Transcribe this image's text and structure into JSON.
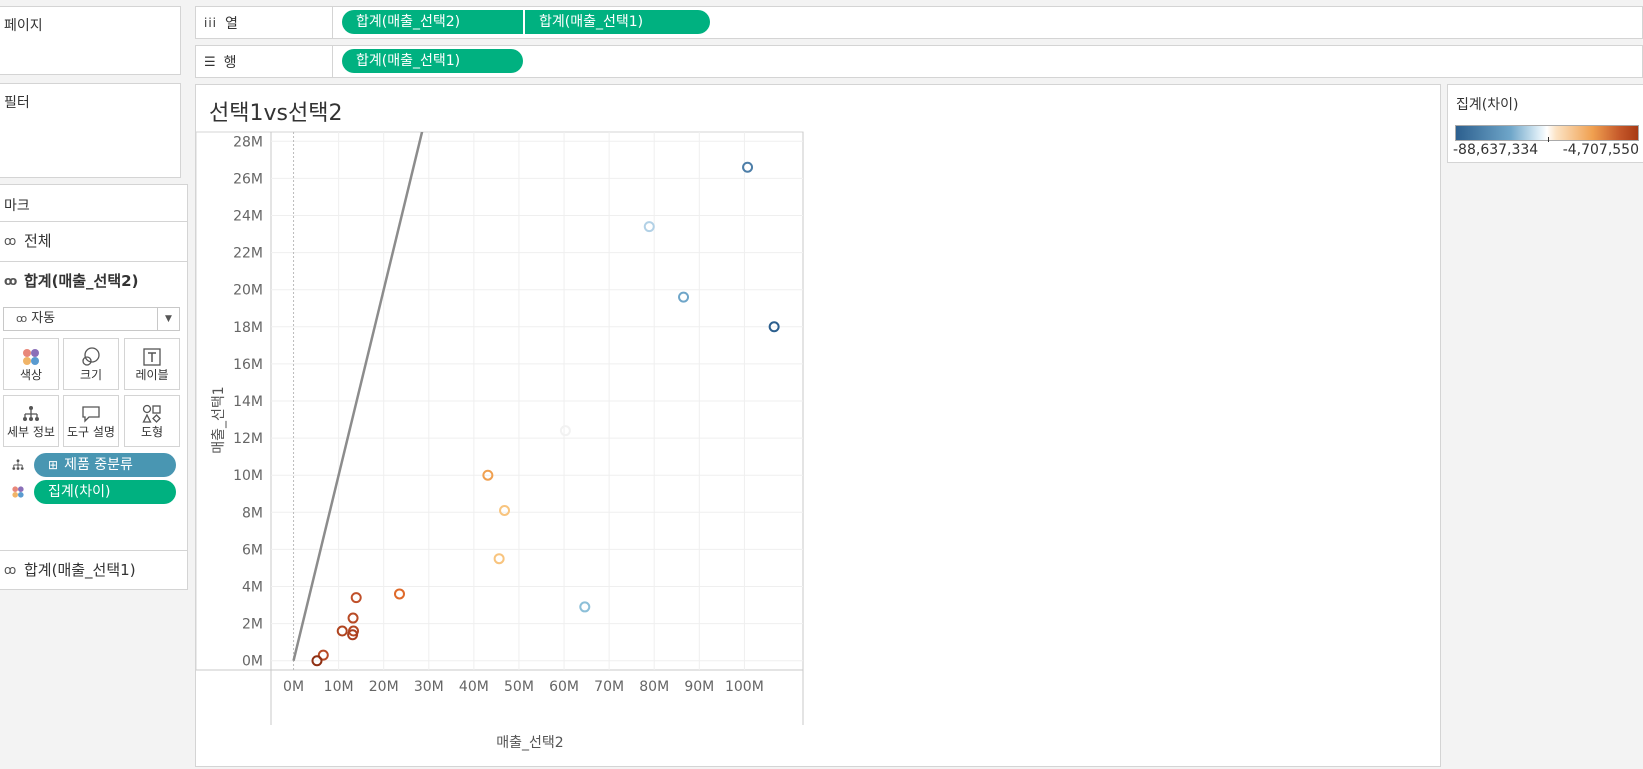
{
  "pages_label": "페이지",
  "filters_label": "필터",
  "marks_label": "마크",
  "columns": {
    "label": "열",
    "pills": [
      "합계(매출_선택2)",
      "합계(매출_선택1)"
    ]
  },
  "rows": {
    "label": "행",
    "pills": [
      "합계(매출_선택1)"
    ]
  },
  "marks_cards": {
    "all": "전체",
    "sel2": "합계(매출_선택2)",
    "sel1": "합계(매출_선택1)"
  },
  "mark_type": "자동",
  "mark_buttons": {
    "color": "색상",
    "size": "크기",
    "label": "레이블",
    "detail": "세부 정보",
    "tooltip": "도구 설명",
    "shape": "도형"
  },
  "mark_fields": {
    "detail_field": "제품 중분류",
    "color_field": "집계(차이)"
  },
  "legend": {
    "title": "집계(차이)",
    "min_label": "-88,637,334",
    "max_label": "-4,707,550"
  },
  "colors": {
    "accent": "#00b180",
    "dimension": "#4996b2"
  },
  "chart_data": {
    "type": "scatter",
    "title": "선택1vs선택2",
    "xlabel": "매출_선택2",
    "ylabel": "매출_선택1",
    "xticks": [
      "0M",
      "10M",
      "20M",
      "30M",
      "40M",
      "50M",
      "60M",
      "70M",
      "80M",
      "90M",
      "100M"
    ],
    "yticks": [
      "0M",
      "2M",
      "4M",
      "6M",
      "8M",
      "10M",
      "12M",
      "14M",
      "16M",
      "18M",
      "20M",
      "22M",
      "24M",
      "26M",
      "28M"
    ],
    "xlim": [
      -5,
      113
    ],
    "ylim": [
      -0.5,
      28.5
    ],
    "units": "M",
    "points": [
      {
        "x": 100.7,
        "y": 26.6,
        "color": "#4d7ea8"
      },
      {
        "x": 78.9,
        "y": 23.4,
        "color": "#b2d1e6"
      },
      {
        "x": 86.5,
        "y": 19.6,
        "color": "#6fa6c9"
      },
      {
        "x": 106.6,
        "y": 18.0,
        "color": "#2c5f8e"
      },
      {
        "x": 60.3,
        "y": 12.4,
        "color": "#f2f2f2"
      },
      {
        "x": 43.1,
        "y": 10.0,
        "color": "#f0a050"
      },
      {
        "x": 46.8,
        "y": 8.1,
        "color": "#f8c47e"
      },
      {
        "x": 45.6,
        "y": 5.5,
        "color": "#f8c47e"
      },
      {
        "x": 64.6,
        "y": 2.9,
        "color": "#8cbfd8"
      },
      {
        "x": 23.5,
        "y": 3.6,
        "color": "#df6a2a"
      },
      {
        "x": 13.9,
        "y": 3.4,
        "color": "#c0502a"
      },
      {
        "x": 13.2,
        "y": 2.3,
        "color": "#b84a25"
      },
      {
        "x": 13.3,
        "y": 1.6,
        "color": "#b54823"
      },
      {
        "x": 13.1,
        "y": 1.4,
        "color": "#a93f20"
      },
      {
        "x": 10.8,
        "y": 1.6,
        "color": "#b0441f"
      },
      {
        "x": 6.6,
        "y": 0.3,
        "color": "#b84a25"
      },
      {
        "x": 5.2,
        "y": 0.0,
        "color": "#8f2f12"
      }
    ],
    "reference_line": {
      "slope": 1
    }
  }
}
